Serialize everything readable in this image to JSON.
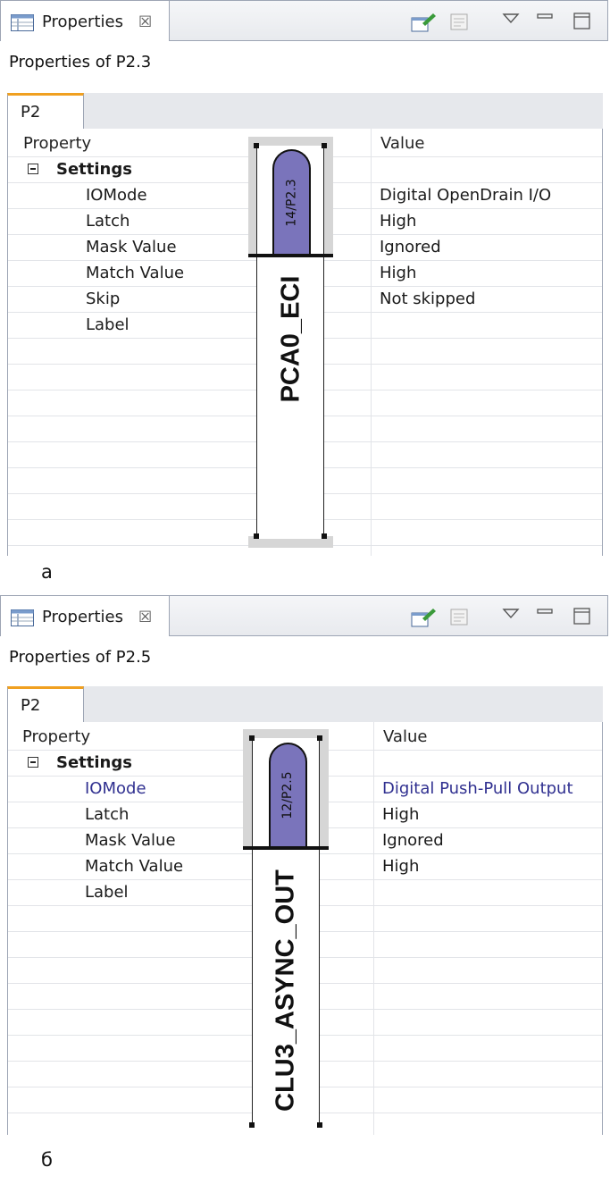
{
  "panels": [
    {
      "view_title": "Properties",
      "properties_of": "Properties of P2.3",
      "tab_label": "P2",
      "columns": {
        "property": "Property",
        "value": "Value"
      },
      "group_label": "Settings",
      "rows": [
        {
          "property": "IOMode",
          "value": "Digital OpenDrain I/O"
        },
        {
          "property": "Latch",
          "value": "High"
        },
        {
          "property": "Mask Value",
          "value": "Ignored"
        },
        {
          "property": "Match Value",
          "value": "High"
        },
        {
          "property": "Skip",
          "value": "Not skipped"
        },
        {
          "property": "Label",
          "value": ""
        }
      ],
      "pin_number": "14/P2.3",
      "pin_function": "PCA0_ECI",
      "caption": "а"
    },
    {
      "view_title": "Properties",
      "properties_of": "Properties of P2.5",
      "tab_label": "P2",
      "columns": {
        "property": "Property",
        "value": "Value"
      },
      "group_label": "Settings",
      "rows": [
        {
          "property": "IOMode",
          "value": "Digital Push-Pull Output"
        },
        {
          "property": "Latch",
          "value": "High"
        },
        {
          "property": "Mask Value",
          "value": "Ignored"
        },
        {
          "property": "Match Value",
          "value": "High"
        },
        {
          "property": "Label",
          "value": ""
        }
      ],
      "pin_number": "12/P2.5",
      "pin_function": "CLU3_ASYNC_OUT",
      "caption": "б"
    }
  ],
  "icons": {
    "view": "properties-table-icon",
    "close": "close-icon",
    "pin": "pin-to-selection-icon",
    "new_view": "new-view-icon",
    "menu": "view-menu-icon",
    "minimize": "minimize-icon",
    "maximize": "maximize-icon"
  },
  "colors": {
    "pin_cap": "#7a74bb",
    "tab_accent": "#f0a020",
    "highlight_text": "#303090"
  },
  "glyphs": {
    "close": "☒"
  }
}
